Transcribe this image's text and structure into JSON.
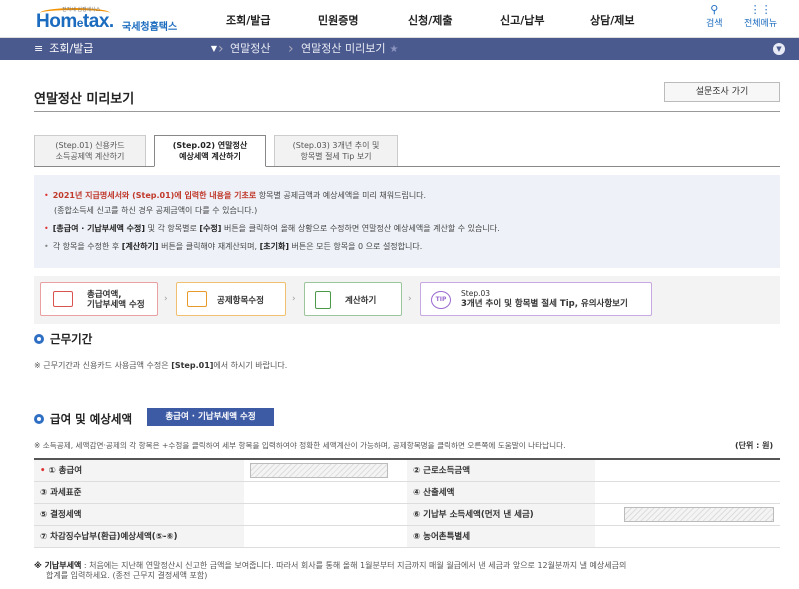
{
  "header": {
    "logo_tiny": "전자세 심쟁세사스",
    "logo_main_a": "Hom",
    "logo_main_e": "e",
    "logo_main_b": "tax.",
    "logo_kr": "국세청홈택스",
    "nav": [
      "조회/발급",
      "민원증명",
      "신청/제출",
      "신고/납부",
      "상담/제보"
    ],
    "search_label": "검색",
    "allmenu_label": "전체메뉴"
  },
  "breadcrumb": {
    "menu": "조회/발급",
    "items": [
      "연말정산",
      "연말정산 미리보기"
    ]
  },
  "page": {
    "title": "연말정산 미리보기",
    "survey_button": "설문조사 가기"
  },
  "tabs": [
    {
      "line1": "(Step.01) 신용카드",
      "line2": "소득공제액 계산하기"
    },
    {
      "line1": "(Step.02) 연말정산",
      "line2": "예상세액 계산하기"
    },
    {
      "line1": "(Step.03) 3개년 추이 및",
      "line2": "항목별 절세 Tip 보기"
    }
  ],
  "info": {
    "l1_red": "2021년 지급명세서와 (Step.01)에 입력한 내용을 기초로",
    "l1_rest": " 항목별 공제금액과 예상세액을 미리 채워드립니다.",
    "l2": "(종합소득세 신고를 하신 경우 공제금액이 다를 수 있습니다.)",
    "l3_b1": "[총급여 · 기납부세액 수정]",
    "l3_m1": " 및 각 항목별로 ",
    "l3_b2": "[수정]",
    "l3_rest": " 버튼을 클릭하여 올해 상황으로 수정하면 연말정산 예상세액을 계산할 수 있습니다.",
    "l4_a": "각 항목을 수정한 후 ",
    "l4_b1": "[계산하기]",
    "l4_m": " 버튼을 클릭해야 재계산되며, ",
    "l4_b2": "[초기화]",
    "l4_rest": " 버튼은 모든 항목을 0 으로 설정합니다."
  },
  "steps": {
    "s1_l1": "총급여액,",
    "s1_l2": "기납부세액 수정",
    "s2": "공제항목수정",
    "s3": "계산하기",
    "s4_badge": "TIP",
    "s4_l1": "Step.03",
    "s4_l2": "3개년 추이 및 항목별 절세 Tip, 유의사항보기"
  },
  "period": {
    "title": "근무기간",
    "note_a": "※ 근무기간과 신용카드 사용금액 수정은 ",
    "note_b": "[Step.01]",
    "note_c": "에서 하시기 바랍니다."
  },
  "salary": {
    "title": "급여 및 예상세액",
    "edit_button": "총급여 · 기납부세액 수정",
    "note": "※ 소득공제, 세액감면·공제의 각 항목은 +수정을 클릭하여 세부 항목을 입력하여야 정확한 세액계산이 가능하며, 공제항목명을 클릭하면 오른쪽에 도움말이 나타납니다.",
    "unit": "(단위 : 원)",
    "rows": [
      {
        "a": "① 총급여",
        "b": "② 근로소득금액"
      },
      {
        "a": "③ 과세표준",
        "b": "④ 산출세액"
      },
      {
        "a": "⑤ 결정세액",
        "b": "⑥ 기납부 소득세액(먼저 낸 세금)"
      },
      {
        "a": "⑦ 차감징수납부(환급)예상세액(⑤-⑥)",
        "b": "⑧ 농어촌특별세"
      }
    ]
  },
  "footer": {
    "b": "※ 기납부세액",
    "l1": " : 처음에는 지난해 연말정산시 신고한 금액을 보여줍니다. 따라서 회사를 통해 올해 1월분부터 지금까지 매월 월급에서 낸 세금과 앞으로 12월분까지 낼 예상세금의",
    "l2": "합계를 입력하세요. (종전 근무지 결정세액 포함)"
  }
}
